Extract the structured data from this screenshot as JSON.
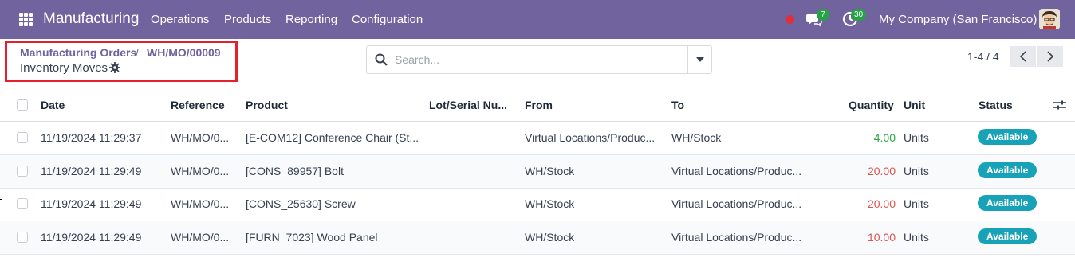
{
  "navbar": {
    "app_name": "Manufacturing",
    "menu": [
      "Operations",
      "Products",
      "Reporting",
      "Configuration"
    ],
    "messages_count": "7",
    "activities_count": "30",
    "company": "My Company (San Francisco)",
    "color": "#71639e"
  },
  "breadcrumb": {
    "parent": "Manufacturing Orders",
    "separator": "/",
    "current": "WH/MO/00009",
    "page_title": "Inventory Moves"
  },
  "search": {
    "placeholder": "Search...",
    "value": ""
  },
  "pager": {
    "range": "1-4 / 4"
  },
  "table": {
    "columns": [
      "Date",
      "Reference",
      "Product",
      "Lot/Serial Nu...",
      "From",
      "To",
      "Quantity",
      "Unit",
      "Status"
    ],
    "rows": [
      {
        "date": "11/19/2024 11:29:37",
        "reference": "WH/MO/0...",
        "product": "[E-COM12] Conference Chair (St...",
        "lot": "",
        "from": "Virtual Locations/Produc...",
        "to": "WH/Stock",
        "quantity": "4.00",
        "unit": "Units",
        "status": "Available"
      },
      {
        "date": "11/19/2024 11:29:49",
        "reference": "WH/MO/0...",
        "product": "[CONS_89957] Bolt",
        "lot": "",
        "from": "WH/Stock",
        "to": "Virtual Locations/Produc...",
        "quantity": "20.00",
        "unit": "Units",
        "status": "Available"
      },
      {
        "date": "11/19/2024 11:29:49",
        "reference": "WH/MO/0...",
        "product": "[CONS_25630] Screw",
        "lot": "",
        "from": "WH/Stock",
        "to": "Virtual Locations/Produc...",
        "quantity": "20.00",
        "unit": "Units",
        "status": "Available"
      },
      {
        "date": "11/19/2024 11:29:49",
        "reference": "WH/MO/0...",
        "product": "[FURN_7023] Wood Panel",
        "lot": "",
        "from": "WH/Stock",
        "to": "Virtual Locations/Produc...",
        "quantity": "10.00",
        "unit": "Units",
        "status": "Available"
      }
    ]
  },
  "colors": {
    "accent": "#71639e",
    "highlight_box": "#e4202f",
    "qty_incoming": "#28a745",
    "qty_outgoing": "#d9534f",
    "status_available": "#17a2b8"
  },
  "icons": [
    "apps-grid-icon",
    "record-dot-icon",
    "chat-icon",
    "activity-clock-icon",
    "gear-icon",
    "search-icon",
    "caret-down-icon",
    "chevron-left-icon",
    "chevron-right-icon",
    "column-settings-icon"
  ]
}
